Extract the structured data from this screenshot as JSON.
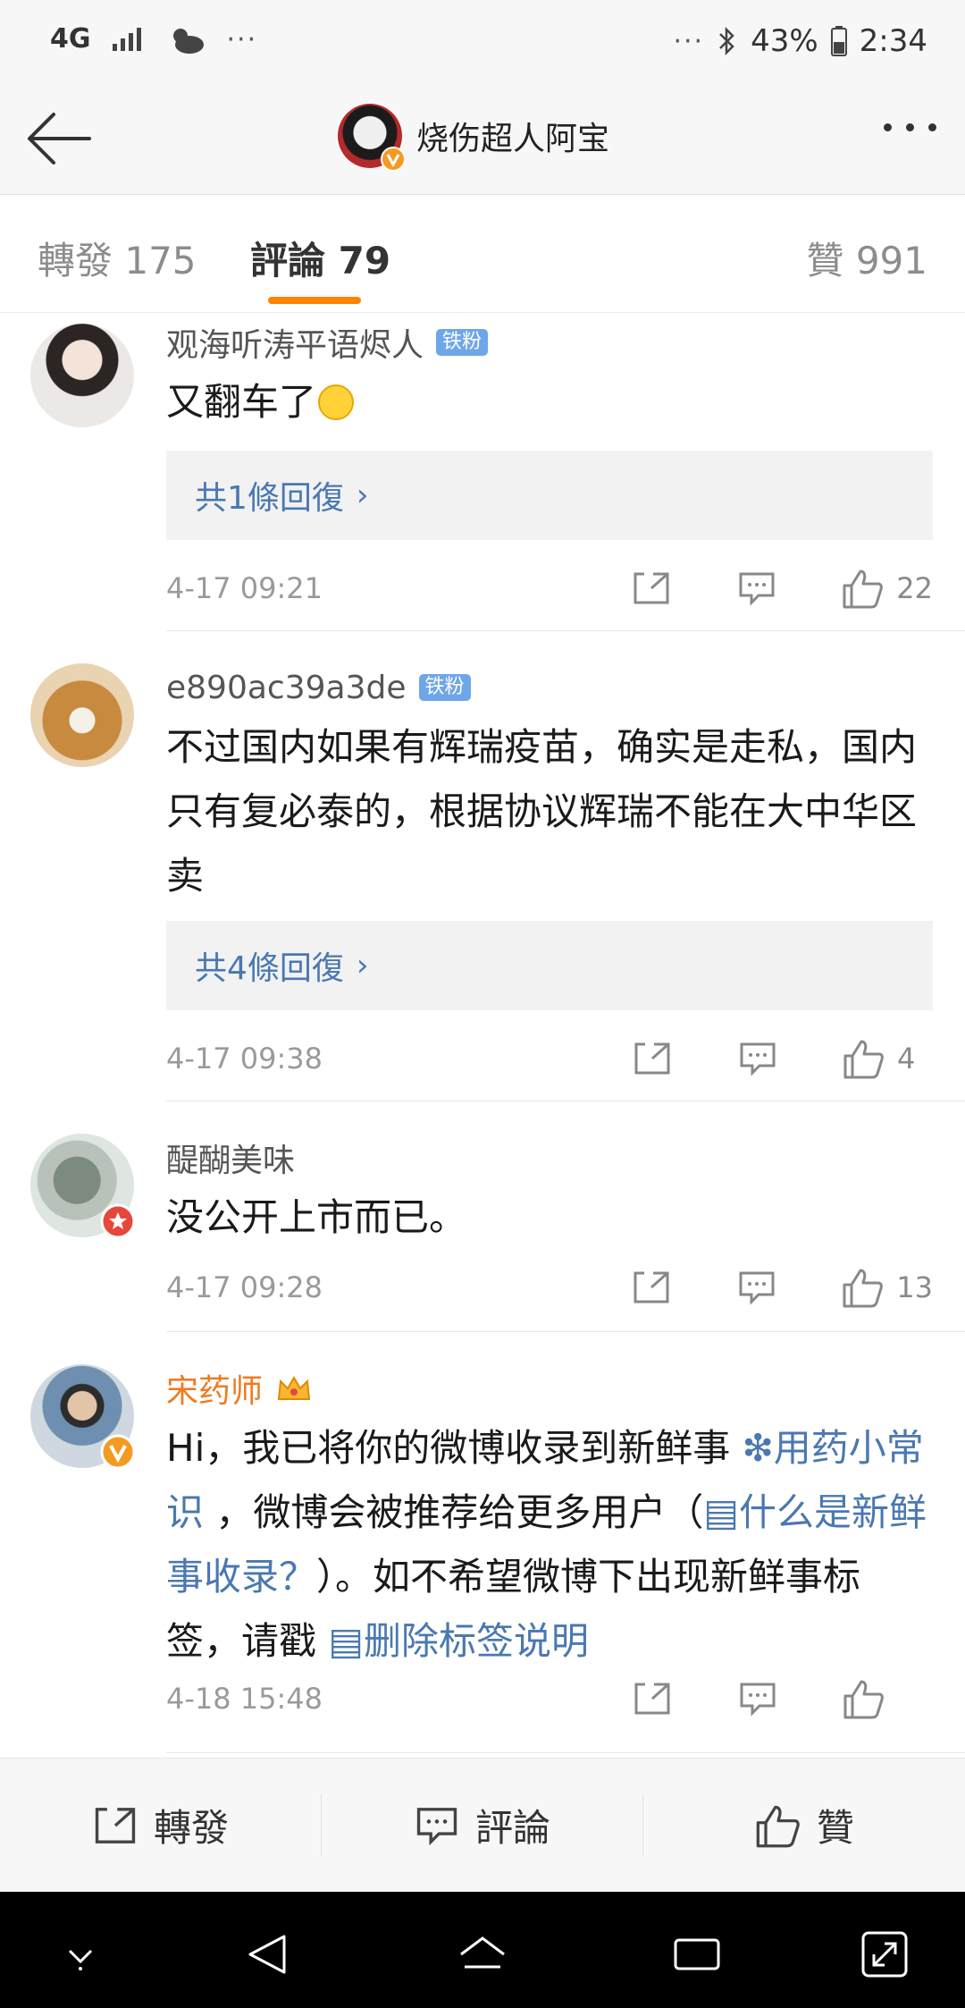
{
  "status_bar": {
    "network": "4G",
    "left_dots": "···",
    "right_dots": "···",
    "battery": "43%",
    "time": "2:34"
  },
  "header": {
    "title": "烧伤超人阿宝"
  },
  "tabs": {
    "repost": "轉發 175",
    "comment": "評論 79",
    "like": "贊 991"
  },
  "comments": [
    {
      "username": "观海听涛平语烬人",
      "badge": "铁粉",
      "text": "又翻车了",
      "reply_summary": "共1條回復",
      "time": "4-17 09:21",
      "likes": "22"
    },
    {
      "username": "e890ac39a3de",
      "badge": "铁粉",
      "text": "不过国内如果有辉瑞疫苗，确实是走私，国内只有复必泰的，根据协议辉瑞不能在大中华区卖",
      "reply_summary": "共4條回復",
      "time": "4-17 09:38",
      "likes": "4"
    },
    {
      "username": "醍醐美味",
      "text": "没公开上市而已。",
      "time": "4-17 09:28",
      "likes": "13"
    },
    {
      "username": "宋药师",
      "text_parts": {
        "p1": "Hi，我已将你的微博收录到新鲜事 ",
        "link1": "❇用药小常识",
        "p2": " ，微博会被推荐给更多用户（",
        "link2": "▤什么是新鲜事收录？",
        "p3": "）。如不希望微博下出现新鲜事标签，请戳 ",
        "link3": "▤删除标签说明"
      },
      "time": "4-18 15:48",
      "likes": ""
    }
  ],
  "bottom_bar": {
    "repost": "轉發",
    "comment": "評論",
    "like": "贊"
  },
  "icons": {
    "accent": "#ff8200",
    "link": "#4a78b0",
    "fan_badge": "#6fa6e8"
  }
}
